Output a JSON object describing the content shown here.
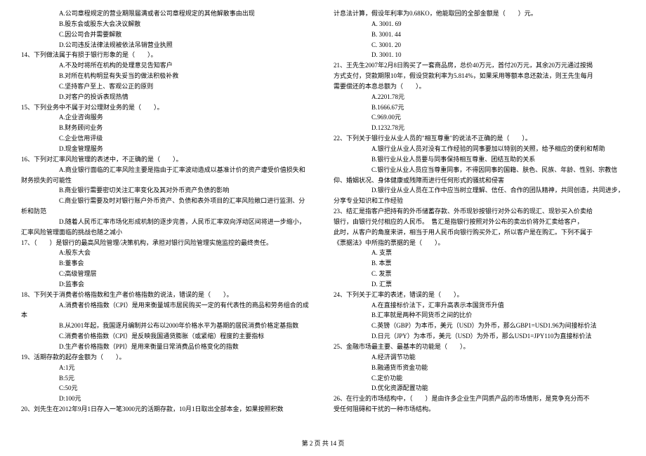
{
  "left": [
    {
      "cls": "indent-opt",
      "t": "A.公司章程规定的营业期限届满或者公司章程规定的其他解散事由出现"
    },
    {
      "cls": "indent-opt",
      "t": "B.股东会或股东大会决议解散"
    },
    {
      "cls": "indent-opt",
      "t": "C.因公司合并需要解散"
    },
    {
      "cls": "indent-opt",
      "t": "D.公司违反法律法规被依法吊销营业执照"
    },
    {
      "cls": "indent-q",
      "t": "14、下列做法属于有损于银行形象的是（　　）。"
    },
    {
      "cls": "indent-opt",
      "t": "A.不及时将所在机构的处理意见告知客户"
    },
    {
      "cls": "indent-opt",
      "t": "B.对所在机构明显有失妥当的做法积极补救"
    },
    {
      "cls": "indent-opt",
      "t": "C.坚持客户至上、客观公正的原则"
    },
    {
      "cls": "indent-opt",
      "t": "D.对客户的投诉表现热情"
    },
    {
      "cls": "indent-q",
      "t": "15、下列业务中不属于对公理财业务的是（　　）。"
    },
    {
      "cls": "indent-opt",
      "t": "A.企业咨询服务"
    },
    {
      "cls": "indent-opt",
      "t": "B.财务顾问业务"
    },
    {
      "cls": "indent-opt",
      "t": "C.企业信用评级"
    },
    {
      "cls": "indent-opt",
      "t": "D.现金管理服务"
    },
    {
      "cls": "indent-q",
      "t": "16、下列对汇率风险管理的表述中，不正确的是（　　）。"
    },
    {
      "cls": "indent-opt",
      "t": "A.商业银行面临的汇率风险主要是指由于汇率波动造成以基准计价的资产遭受价值损失和"
    },
    {
      "cls": "indent-cont",
      "t": "财务损失的可能性"
    },
    {
      "cls": "indent-opt",
      "t": "B.商业银行需要密切关注汇率变化及其对外币资产负债的影响"
    },
    {
      "cls": "indent-opt",
      "t": "C.商业银行需要及时对银行账户外币资产、负债和表外项目的汇率风险敞口进行监测、分"
    },
    {
      "cls": "indent-cont",
      "t": "析和防范"
    },
    {
      "cls": "indent-opt",
      "t": "D.随着人民币汇率市场化形成机制的逐步完善，人民币汇率双向浮动区间将进一步缩小，"
    },
    {
      "cls": "indent-cont",
      "t": "汇率风险管理面临的挑战也随之减小"
    },
    {
      "cls": "indent-q",
      "t": "17、（　　）是银行的最高风险管理/决策机构，承担对银行风险管理实施监控的最终责任。"
    },
    {
      "cls": "indent-opt",
      "t": "A:股东大会"
    },
    {
      "cls": "indent-opt",
      "t": "B:董事会"
    },
    {
      "cls": "indent-opt",
      "t": "C:高级管理层"
    },
    {
      "cls": "indent-opt",
      "t": "D:监事会"
    },
    {
      "cls": "indent-q",
      "t": "18、下列关于消费者价格指数和生产者价格指数的说法，错误的是（　　）。"
    },
    {
      "cls": "indent-opt",
      "t": "A.消费者价格指数（CPI）是用来衡量城市居民购买一定的有代表性的商品和劳务组合的成"
    },
    {
      "cls": "indent-cont",
      "t": "本"
    },
    {
      "cls": "indent-opt",
      "t": "B.从2001年起，我国逐月编制并公布以2000年价格水平为基期的居民消费价格定基指数"
    },
    {
      "cls": "indent-opt",
      "t": "C.消费者价格指数（CPI）是反映我国通货膨胀（或紧缩）程度的主要指标"
    },
    {
      "cls": "indent-opt",
      "t": "D.生产者价格指数（PPI）是用来衡量日常消费品价格变化的指数"
    },
    {
      "cls": "indent-q",
      "t": "19、活期存款的起存金额为（　　）。"
    },
    {
      "cls": "indent-opt",
      "t": "A:1元"
    },
    {
      "cls": "indent-opt",
      "t": "B:5元"
    },
    {
      "cls": "indent-opt",
      "t": "C:50元"
    },
    {
      "cls": "indent-opt",
      "t": "D:100元"
    },
    {
      "cls": "indent-q",
      "t": "20、刘先生在2012年9月1日存入一笔3000元的活期存款，10月1日取出全部本金，如果按照积数"
    }
  ],
  "right": [
    {
      "cls": "indent-cont",
      "t": "计息法计算，假设年利率为0.68KO，他能取回的全部金额是（　　）元。"
    },
    {
      "cls": "indent-opt",
      "t": "A. 3001. 69"
    },
    {
      "cls": "indent-opt",
      "t": "B. 3001. 44"
    },
    {
      "cls": "indent-opt",
      "t": "C. 3001. 20"
    },
    {
      "cls": "indent-opt",
      "t": "D. 3001. 10"
    },
    {
      "cls": "indent-q",
      "t": "21、王先生2007年2月8日购买了一套商品房，总价40万元，首付20万元，其余20万元通过按揭"
    },
    {
      "cls": "indent-cont",
      "t": "方式支付，贷款期限10年，假设贷款利率为5.814%，如果采用等额本息还款法，则王先生每月"
    },
    {
      "cls": "indent-cont",
      "t": "需要偿还的本息总额为（　　）。"
    },
    {
      "cls": "indent-opt",
      "t": "A.2201.78元"
    },
    {
      "cls": "indent-opt",
      "t": "B.1666.67元"
    },
    {
      "cls": "indent-opt",
      "t": "C.969.00元"
    },
    {
      "cls": "indent-opt",
      "t": "D.1232.78元"
    },
    {
      "cls": "indent-q",
      "t": "22、下列关于银行业从业人员的\"相互尊重\"的说法不正确的是（　　）。"
    },
    {
      "cls": "indent-opt",
      "t": "A.银行业从业人员对没有工作经验的同事要加以特别的关照，给予相应的便利和帮助"
    },
    {
      "cls": "indent-opt",
      "t": "B.银行业从业人员要与同事保持相互尊重、团结互助的关系"
    },
    {
      "cls": "indent-opt",
      "t": "C.银行业从业人员应当尊重同事，不得因同事的国籍、肤色、民族、年龄、性别、宗教信"
    },
    {
      "cls": "indent-cont",
      "t": "仰、婚姻状况、身体健康或残障而进行任何形式的骚扰和侵害"
    },
    {
      "cls": "indent-opt",
      "t": "D.银行业从业人员在工作中应当树立理解、信任、合作的团队精神，共同创造，共同进步，"
    },
    {
      "cls": "indent-cont",
      "t": "分享专业知识和工作经验"
    },
    {
      "cls": "indent-q",
      "t": "23、结汇是指客户把持有的外币储蓄存款、外币现钞按银行对外公布的现汇、现钞买入价卖给"
    },
    {
      "cls": "indent-cont",
      "t": "银行，由银行兑付相应的人民币。　售汇是指银行按照对外公布的卖出价将外汇卖给客户，"
    },
    {
      "cls": "indent-cont",
      "t": "此时，从客户的角度来讲，相当于用人民币向银行购买外汇，所以客户是在购汇。下列不属于"
    },
    {
      "cls": "indent-cont",
      "t": "《票据法》中所指的票据的是（　　）。"
    },
    {
      "cls": "indent-opt",
      "t": "A. 支票"
    },
    {
      "cls": "indent-opt",
      "t": "B. 本票"
    },
    {
      "cls": "indent-opt",
      "t": "C. 发票"
    },
    {
      "cls": "indent-opt",
      "t": "D. 汇票"
    },
    {
      "cls": "indent-q",
      "t": "24、下列关于汇率的表述，错误的是（　　）。"
    },
    {
      "cls": "indent-opt",
      "t": "A.在直接标价法下，汇率升高表示本国货币升值"
    },
    {
      "cls": "indent-opt",
      "t": "B.汇率就是两种不同货币之间的比价"
    },
    {
      "cls": "indent-opt",
      "t": "C.英镑（GBP）为本币，美元（USD）为外币，那么GBP1=USD1.96为间接标价法"
    },
    {
      "cls": "indent-opt",
      "t": "D.日元（JPY）为本币，美元（USD）为外币，那么USD1=JPY110为直接标价法"
    },
    {
      "cls": "indent-q",
      "t": "25、金融市场最主要、最基本的功能是（　　）。"
    },
    {
      "cls": "indent-opt",
      "t": "A.经济调节功能"
    },
    {
      "cls": "indent-opt",
      "t": "B.融通货币资金功能"
    },
    {
      "cls": "indent-opt",
      "t": "C.定价功能"
    },
    {
      "cls": "indent-opt",
      "t": "D.优化资源配置功能"
    },
    {
      "cls": "indent-q",
      "t": "26、在行业的市场结构中，（　　）是由许多企业生产同质产品的市场情形，是竞争充分而不"
    },
    {
      "cls": "indent-cont",
      "t": "受任何阻碍和干扰的一种市场结构。"
    }
  ],
  "footer": "第 2 页 共 14 页"
}
